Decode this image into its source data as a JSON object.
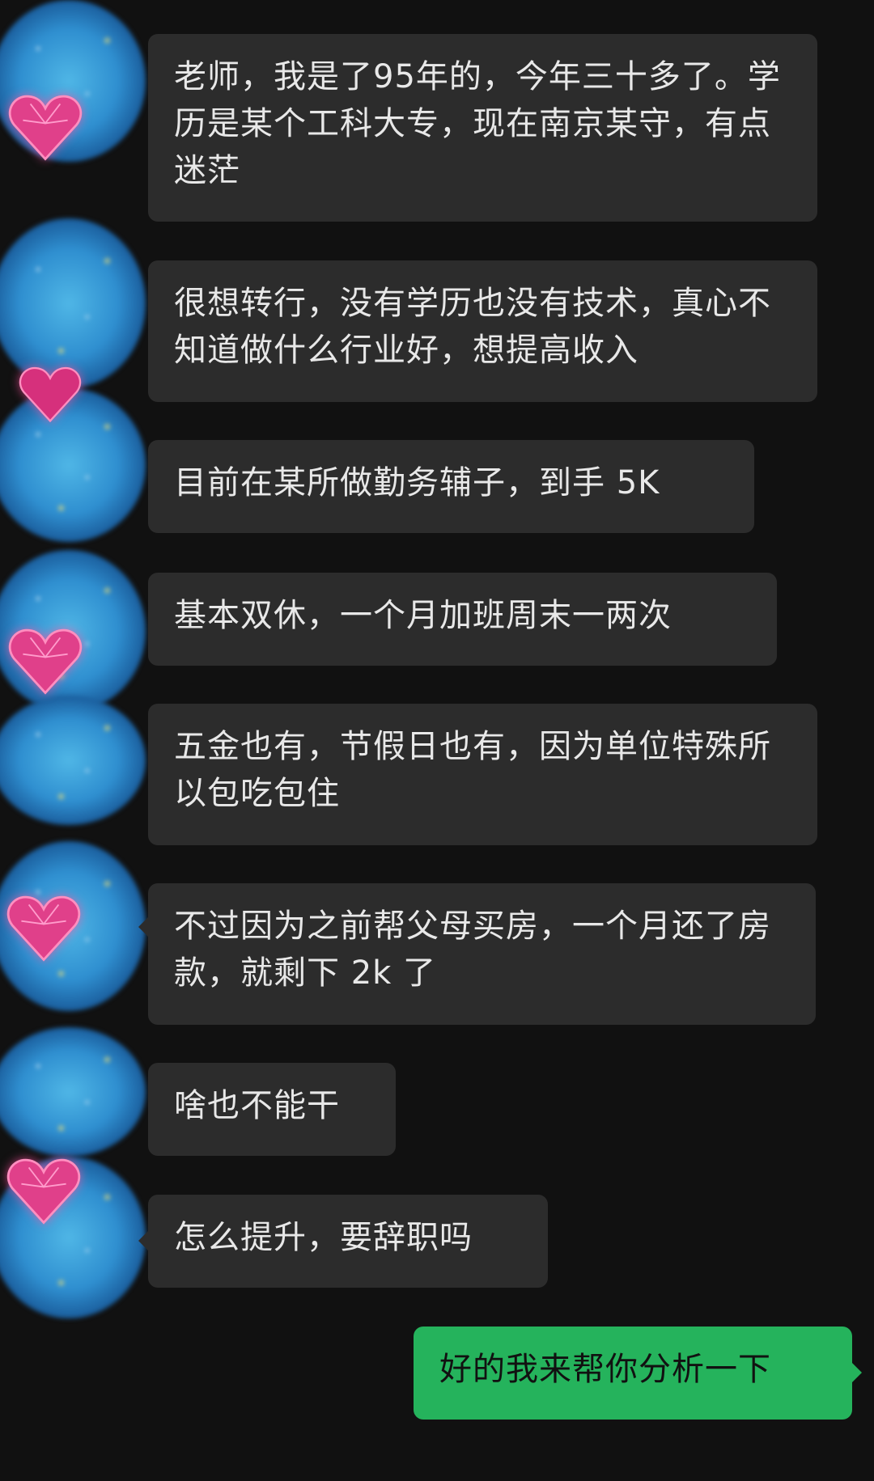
{
  "conversation": {
    "messages": [
      {
        "sender": "other",
        "text": "老师，我是了95年的，今年三十多了。学历是某个工科大专，现在南京某守，有点迷茫"
      },
      {
        "sender": "other",
        "text": "很想转行，没有学历也没有技术，真心不知道做什么行业好，想提高收入"
      },
      {
        "sender": "other",
        "text": "目前在某所做勤务辅子，到手 5K"
      },
      {
        "sender": "other",
        "text": "基本双休，一个月加班周末一两次"
      },
      {
        "sender": "other",
        "text": "五金也有，节假日也有，因为单位特殊所以包吃包住"
      },
      {
        "sender": "other",
        "text": "不过因为之前帮父母买房，一个月还了房款，就剩下 2k 了"
      },
      {
        "sender": "other",
        "text": "啥也不能干"
      },
      {
        "sender": "other",
        "text": "怎么提升，要辞职吗"
      },
      {
        "sender": "me",
        "text": "好的我来帮你分析一下"
      }
    ]
  },
  "colors": {
    "background": "#111111",
    "incoming_bubble": "#2c2c2c",
    "outgoing_bubble": "#25b35c",
    "incoming_text": "#e8e8e8",
    "outgoing_text": "#111111"
  },
  "icons": {
    "avatar": "sparkly-blue-heart-avatar-icon"
  }
}
